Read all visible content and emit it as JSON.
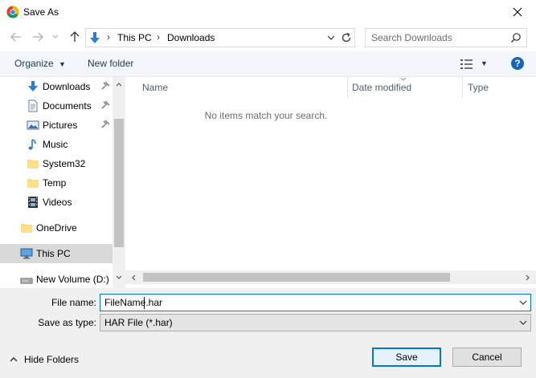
{
  "window": {
    "title": "Save As"
  },
  "nav": {
    "breadcrumbs": [
      "This PC",
      "Downloads"
    ],
    "search_placeholder": "Search Downloads"
  },
  "toolbar": {
    "organize": "Organize",
    "new_folder": "New folder",
    "help": "?"
  },
  "sidebar": {
    "items": [
      {
        "label": "Downloads",
        "icon": "download-arrow-icon",
        "pinned": true
      },
      {
        "label": "Documents",
        "icon": "document-icon",
        "pinned": true
      },
      {
        "label": "Pictures",
        "icon": "pictures-icon",
        "pinned": true
      },
      {
        "label": "Music",
        "icon": "music-note-icon",
        "pinned": false
      },
      {
        "label": "System32",
        "icon": "folder-icon",
        "pinned": false
      },
      {
        "label": "Temp",
        "icon": "folder-icon",
        "pinned": false
      },
      {
        "label": "Videos",
        "icon": "film-icon",
        "pinned": false
      },
      {
        "label": "OneDrive",
        "icon": "folder-icon",
        "pinned": false
      },
      {
        "label": "This PC",
        "icon": "computer-icon",
        "selected": true
      },
      {
        "label": "New Volume (D:)",
        "icon": "drive-icon",
        "pinned": false
      }
    ]
  },
  "filelist": {
    "columns": [
      "Name",
      "Date modified",
      "Type"
    ],
    "empty_message": "No items match your search."
  },
  "form": {
    "filename_label": "File name:",
    "filename_value": "FileName.har",
    "type_label": "Save as type:",
    "type_value": "HAR File (*.har)"
  },
  "footer": {
    "hide_folders": "Hide Folders",
    "save": "Save",
    "cancel": "Cancel"
  },
  "colors": {
    "accent": "#0078d7",
    "help_blue": "#1565c0",
    "selection": "#d9d9d9"
  }
}
